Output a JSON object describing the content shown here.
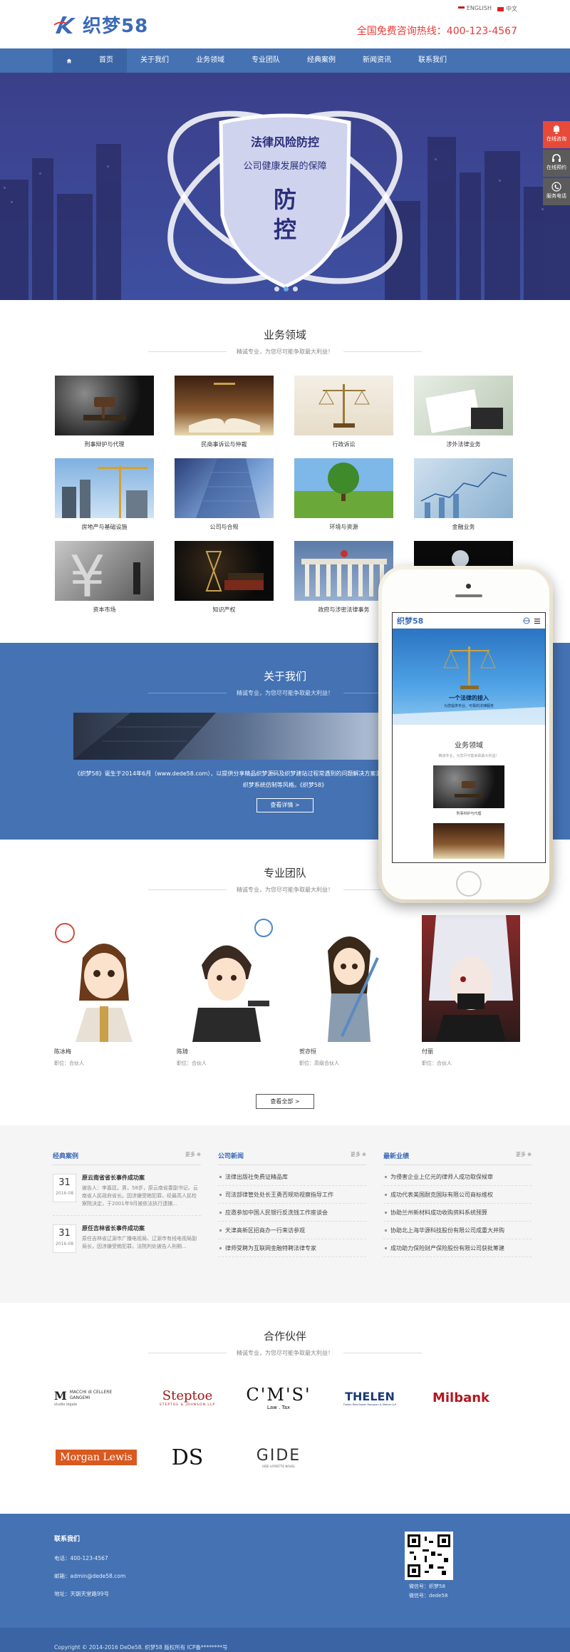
{
  "header": {
    "logo_text": "织梦58",
    "lang_en": "ENGLISH",
    "lang_cn": "中文",
    "hotline": "全国免费咨询热线：400-123-4567"
  },
  "nav": {
    "items": [
      "首页",
      "关于我们",
      "业务领域",
      "专业团队",
      "经典案例",
      "新闻资讯",
      "联系我们"
    ]
  },
  "banner": {
    "line1": "法律风险防控",
    "line2": "公司健康发展的保障",
    "big": "防控"
  },
  "side": {
    "consult": "在线咨询",
    "appointment": "在线预约",
    "phone": "服务电话"
  },
  "business": {
    "title": "业务领域",
    "subtitle": "精诚专业，为您尽可能争取最大利益！",
    "items": [
      "刑事辩护与代理",
      "民商事诉讼与仲裁",
      "行政诉讼",
      "涉外法律业务",
      "房地产与基础设施",
      "公司与合规",
      "环境与资源",
      "金融业务",
      "资本市场",
      "知识产权",
      "政府与涉密法律事务",
      ""
    ]
  },
  "about": {
    "title": "关于我们",
    "subtitle": "精诚专业，为您尽可能争取最大利益！",
    "text": "《织梦58》诞生于2014年6月（www.dede58.com），以提供分享精品织梦源码及织梦建站过程常遇到的问题解决方案汇总为户美织梦源码，及工作室成绩备美等基于织梦系统仿制等风格。《织梦58》",
    "button": "查看详情 >"
  },
  "team": {
    "title": "专业团队",
    "subtitle": "精诚专业，为您尽可能争取最大利益！",
    "members": [
      {
        "name": "陈冰梅",
        "role": "职位：合伙人"
      },
      {
        "name": "陈琦",
        "role": "职位：合伙人"
      },
      {
        "name": "贺亦恒",
        "role": "职位：高级合伙人"
      },
      {
        "name": "付丽",
        "role": "职位：合伙人"
      }
    ],
    "button": "查看全部 >"
  },
  "news": {
    "more": "更多",
    "cases_title": "经典案例",
    "cases": [
      {
        "day": "31",
        "ym": "2016-08",
        "title": "原云南省省长事件成功案",
        "desc": "被告人：李嘉廷，男，58岁，原云南省委副书记、云南省人民政府省长。因涉嫌受贿犯罪，经最高人民检察院决定，于2001年9月被依法执行逮捕..."
      },
      {
        "day": "31",
        "ym": "2016-08",
        "title": "原任吉林省长事件成功案",
        "desc": "原任吉林省辽源市广播电视局、辽源市有线电视局副局长，因涉嫌受贿犯罪，法院判处被告人刑期..."
      }
    ],
    "company_title": "公司新闻",
    "company": [
      "法律出版社免费证精品库",
      "司法部律管处处长王勇否规劝视察指导工作",
      "应邀参加中国人民银行反洗钱工作座谈会",
      "天津高新区招商办一行来访参观",
      "律师受聘为互联网金融特聘法律专家"
    ],
    "industry_title": "最新业绩",
    "industry": [
      "为侵害企业上亿元的律师人成功取保候审",
      "成功代表美国耐克国际有限公司商标维权",
      "协助兰州新材料成功收购资料系统预算",
      "协助北上海华源科技股份有限公司成重大并购",
      "成功助力保险财产保险股份有限公司获批筹建"
    ]
  },
  "partners": {
    "title": "合作伙伴",
    "subtitle": "精诚专业，为您尽可能争取最大利益！",
    "logos": [
      "MACCHI di CELLERE GANGEMI",
      "Steptoe",
      "C'M'S'",
      "THELEN",
      "Milbank",
      "Morgan Lewis",
      "DS",
      "GIDE"
    ],
    "sublines": [
      "studio legale",
      "STEPTOE & JOHNSON LLP",
      "Law . Tax",
      "Thelen Reid Brown Raysman & Steiner LLP",
      "",
      "",
      "",
      "GIDE LOYRETTE NOUEL"
    ]
  },
  "contact": {
    "title": "联系我们",
    "phone": "电话：400-123-4567",
    "email": "邮箱：admin@dede58.com",
    "address": "地址：天朝天堂路99号",
    "qr_caption1": "微信号：织梦58",
    "qr_caption2": "微信号：dede58"
  },
  "footer": {
    "copyright": "Copyright © 2014-2016 DeDe58. 织梦58 版权所有     ICP备********号"
  },
  "phone_mock": {
    "logo": "织梦58",
    "banner_line1": "一个法律的接入",
    "banner_line2": "为您提供专业、可靠的法律服务",
    "title": "业务领域",
    "subtitle": "精诚专业，为您尽可能争取最大利益！",
    "label": "刑事辩护与代理"
  },
  "colors": {
    "brand_blue": "#4472b3",
    "nav_active": "#3a64a4",
    "hotline_red": "#e83a3a",
    "side_red": "#e84a3a"
  }
}
